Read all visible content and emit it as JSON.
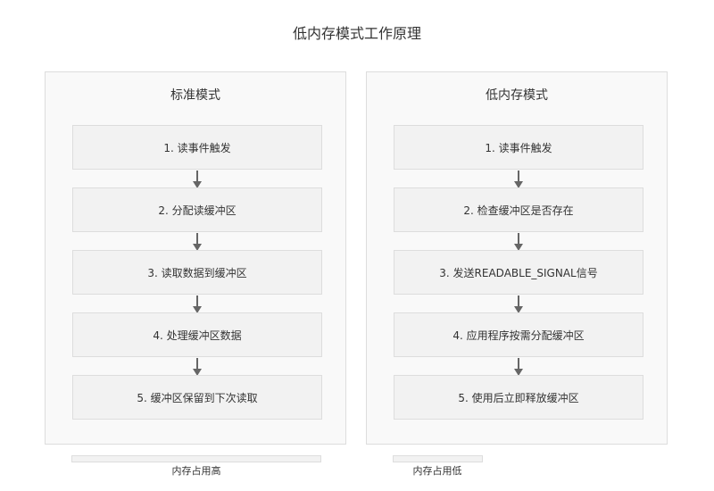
{
  "title": "低内存模式工作原理",
  "panels": [
    {
      "title": "标准模式",
      "steps": [
        "1. 读事件触发",
        "2. 分配读缓冲区",
        "3. 读取数据到缓冲区",
        "4. 处理缓冲区数据",
        "5. 缓冲区保留到下次读取"
      ],
      "memory_label": "内存占用高",
      "memory_level": 1.0
    },
    {
      "title": "低内存模式",
      "steps": [
        "1. 读事件触发",
        "2. 检查缓冲区是否存在",
        "3. 发送READABLE_SIGNAL信号",
        "4. 应用程序按需分配缓冲区",
        "5. 使用后立即释放缓冲区"
      ],
      "memory_label": "内存占用低",
      "memory_level": 0.36
    }
  ],
  "colors": {
    "panel_bg": "#f9f9f9",
    "step_bg": "#f2f2f2",
    "border": "#dddddd",
    "arrow": "#666666",
    "text": "#333333"
  }
}
